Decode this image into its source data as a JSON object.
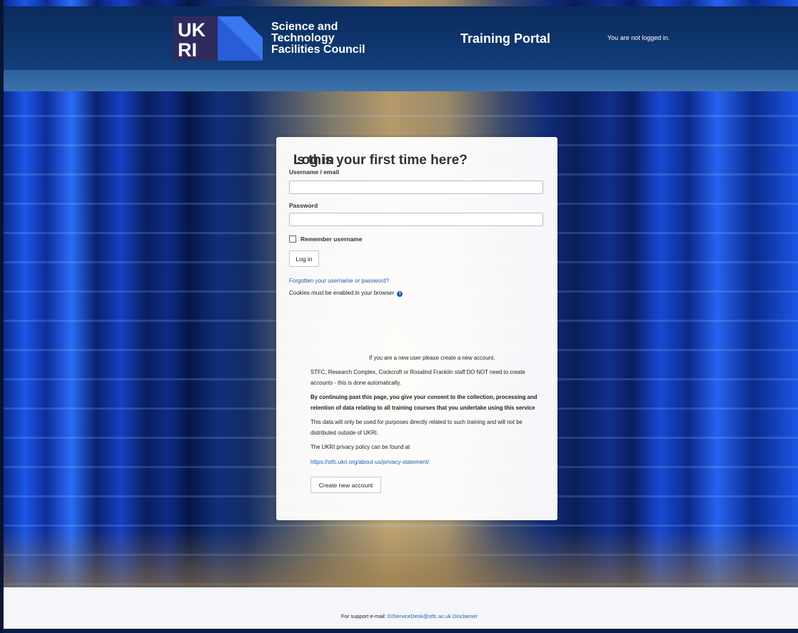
{
  "header": {
    "org_name_lines": [
      "Science and",
      "Technology",
      "Facilities Council"
    ],
    "portal_title": "Training Portal",
    "login_status": "You are not logged in."
  },
  "login": {
    "title": "Log in",
    "username_label": "Username / email",
    "username_value": "",
    "password_label": "Password",
    "password_value": "",
    "remember_label": "Remember username",
    "remember_checked": false,
    "login_button": "Log in",
    "forgot_link": "Forgotten your username or password?",
    "cookies_note": "Cookies must be enabled in your browser"
  },
  "first_time": {
    "title": "Is this your first time here?",
    "intro": "If you are a new user please create a new account.",
    "staff_note_1": "STFC, Research Complex, Cockcroft or Rosalind Franklin staff DO NOT need to create",
    "staff_note_2": "accounts - this is done automatically.",
    "consent_1": "By continuing past this page, you give your consent to the collection, processing and",
    "consent_2": "retention of data relating to all training courses that you undertake using this service",
    "usage_1": "This data will only be used for purposes directly related to such training and will not be",
    "usage_2": "distributed outside of UKRI.",
    "privacy_note": "The UKRI privacy policy can be found at",
    "privacy_link": "https://stfc.ukri.org/about-us/privacy-statement/",
    "create_button": "Create new account"
  },
  "footer": {
    "support_prefix": "For support e-mail:",
    "support_email": "DIServiceDesk@stfc.ac.uk",
    "disclaimer": "Disclaimer"
  },
  "colors": {
    "header_bg": "#0a2a5c",
    "link": "#1d5db4"
  }
}
